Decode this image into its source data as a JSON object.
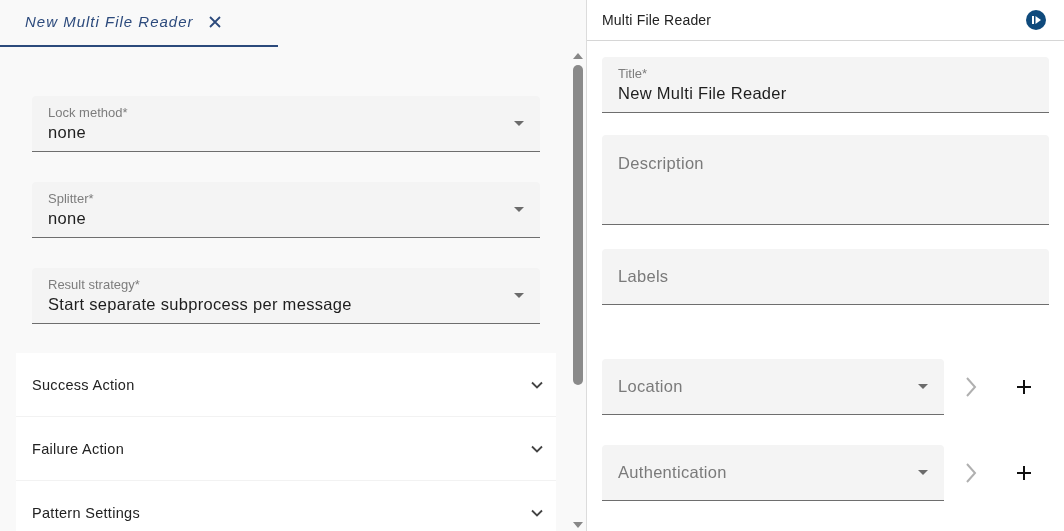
{
  "editor_tab": {
    "title": "New Multi File Reader",
    "selected": true
  },
  "left_fields": [
    {
      "kind": "select",
      "label": "Lock method*",
      "value": "none"
    },
    {
      "kind": "select",
      "label": "Splitter*",
      "value": "none"
    },
    {
      "kind": "select",
      "label": "Result strategy*",
      "value": "Start separate subprocess per message"
    }
  ],
  "sections": [
    {
      "title": "Success Action",
      "expanded": false
    },
    {
      "title": "Failure Action",
      "expanded": false
    },
    {
      "title": "Pattern Settings",
      "expanded": false
    }
  ],
  "properties_panel": {
    "title": "Multi File Reader",
    "fields": [
      {
        "kind": "text",
        "label": "Title*",
        "value": "New Multi File Reader"
      },
      {
        "kind": "textarea",
        "placeholder": "Description"
      },
      {
        "kind": "text",
        "placeholder": "Labels"
      },
      {
        "kind": "select",
        "placeholder": "Location",
        "navigate_disabled": true
      },
      {
        "kind": "select",
        "placeholder": "Authentication",
        "navigate_disabled": true
      }
    ]
  }
}
